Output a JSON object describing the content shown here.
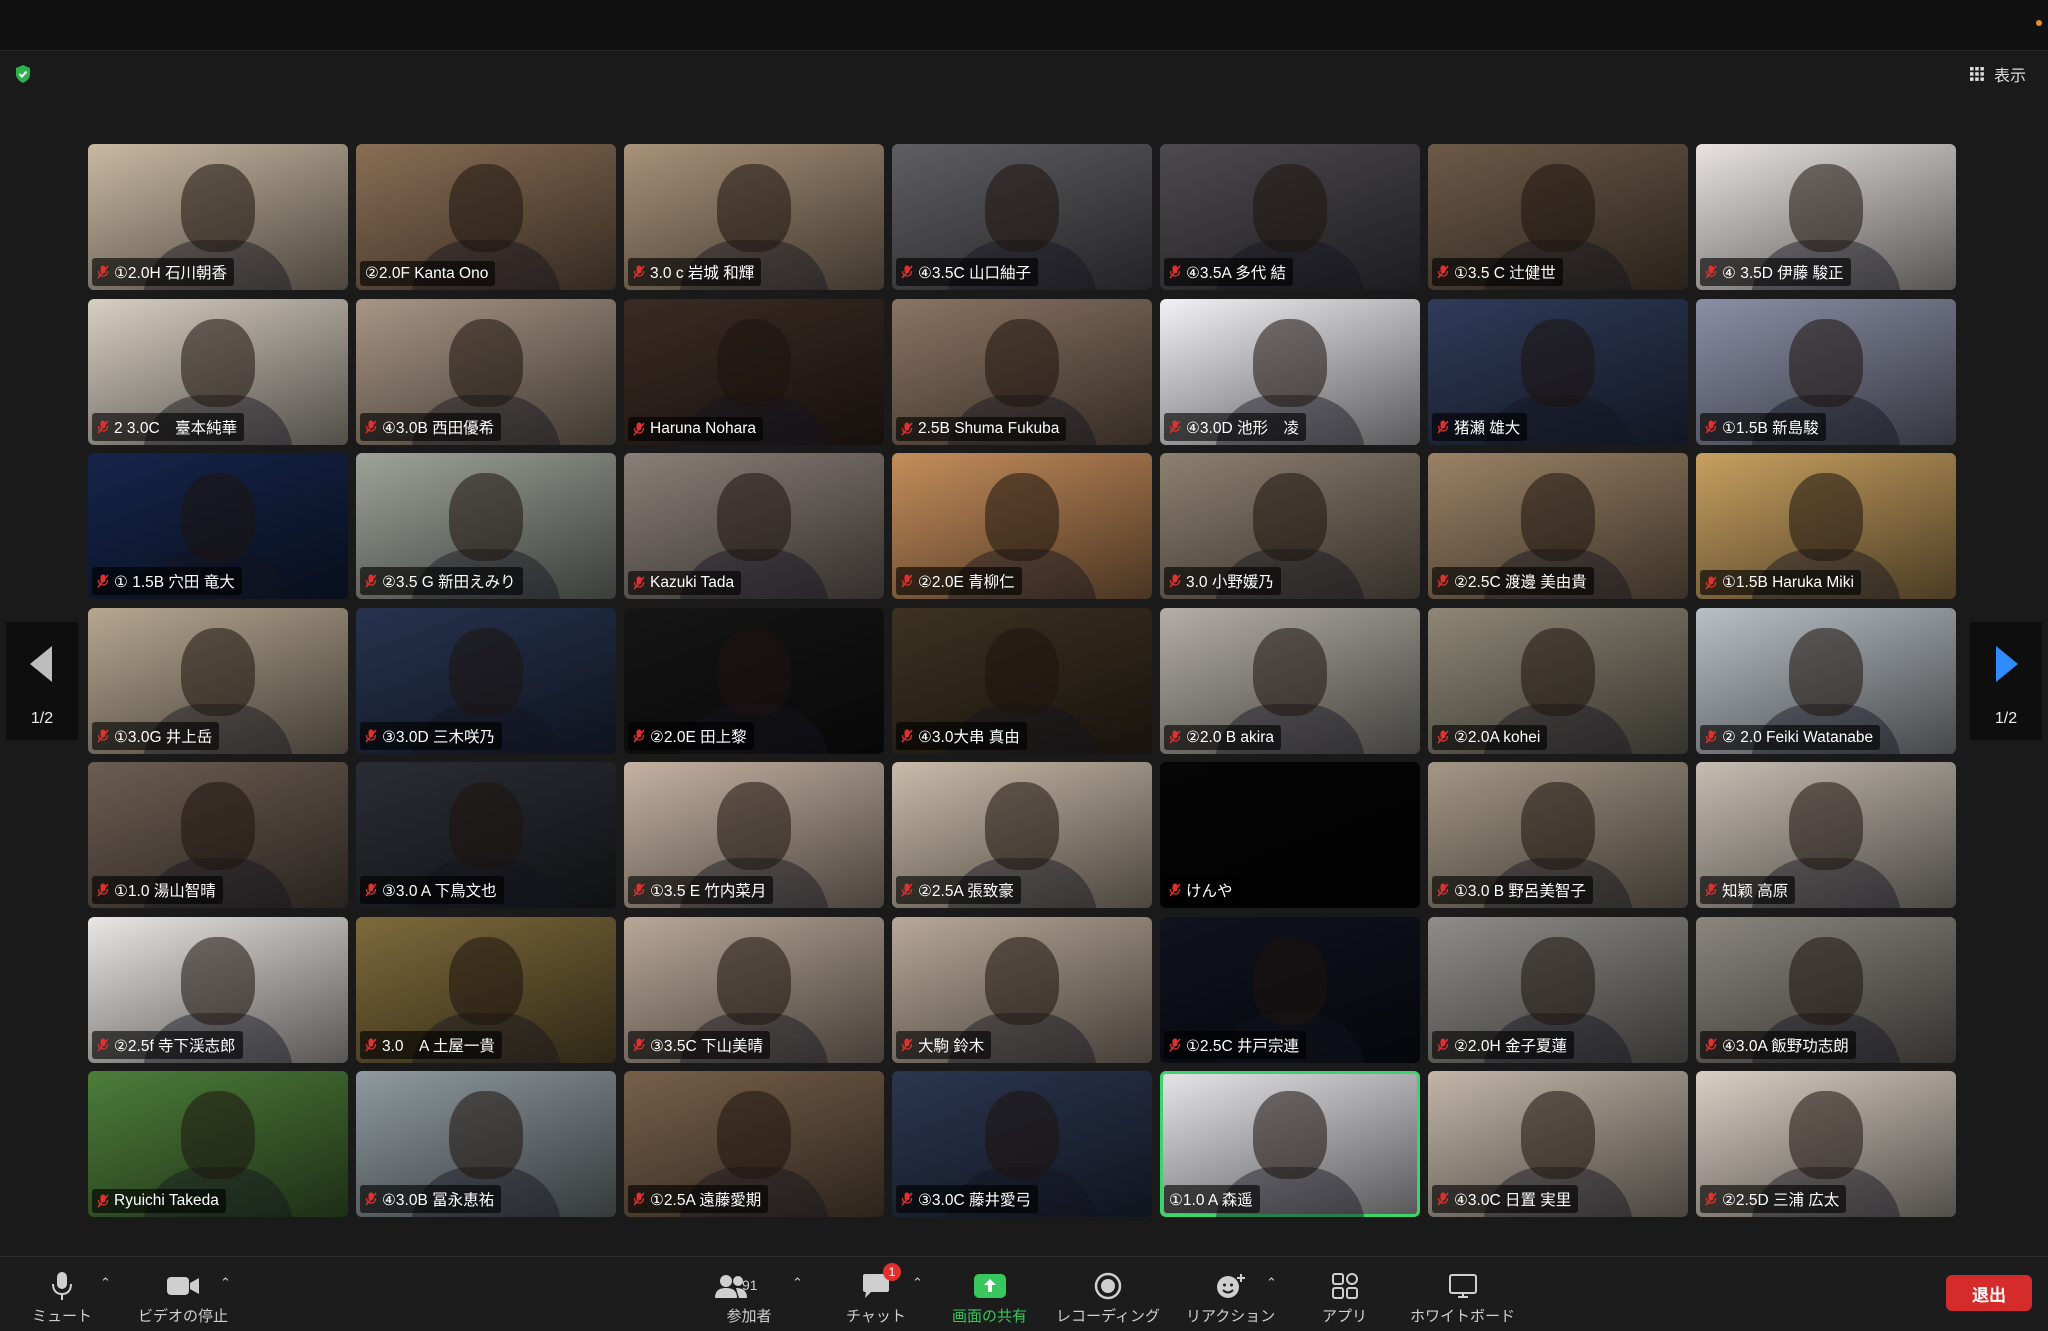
{
  "meeting": {
    "view_label": "表示",
    "page_indicator": "1/2",
    "colors": {
      "active_speaker_border": "#3fd36d",
      "leave_button": "#d62b2b",
      "share_green": "#38c75d",
      "muted_mic": "#e0302f"
    }
  },
  "participants": [
    {
      "name": "①2.0H 石川朝香",
      "bg": "#c9b9a3",
      "muted": true
    },
    {
      "name": "②2.0F Kanta Ono",
      "bg": "#8a6e55",
      "muted": false
    },
    {
      "name": "3.0 c 岩城 和輝",
      "bg": "#a89279",
      "muted": true
    },
    {
      "name": "④3.5C 山口紬子",
      "bg": "#5f5e63",
      "muted": true
    },
    {
      "name": "④3.5A 多代 結",
      "bg": "#4c4a4f",
      "muted": true
    },
    {
      "name": "①3.5 C 辻健世",
      "bg": "#6d5a48",
      "muted": true
    },
    {
      "name": "④ 3.5D 伊藤 駿正",
      "bg": "#e8e3e0",
      "muted": true
    },
    {
      "name": "2 3.0C　臺本純華",
      "bg": "#d8cfc2",
      "muted": true
    },
    {
      "name": "④3.0B 西田優希",
      "bg": "#a89584",
      "muted": true
    },
    {
      "name": "Haruna Nohara",
      "bg": "#3b2b24",
      "muted": true
    },
    {
      "name": "2.5B Shuma Fukuba",
      "bg": "#8b7462",
      "muted": true
    },
    {
      "name": "④3.0D 池形　凌",
      "bg": "#f2f2f6",
      "muted": true
    },
    {
      "name": "猪瀬 雄大",
      "bg": "#2f3b5a",
      "muted": true
    },
    {
      "name": "①1.5B 新島駿",
      "bg": "#8b8fa6",
      "muted": true
    },
    {
      "name": "① 1.5B 穴田 竜大",
      "bg": "#15254a",
      "muted": true
    },
    {
      "name": "②3.5 G 新田えみり",
      "bg": "#9ea39a",
      "muted": true
    },
    {
      "name": "Kazuki Tada",
      "bg": "#8a7f78",
      "muted": true
    },
    {
      "name": "②2.0E 青柳仁",
      "bg": "#c58d5b",
      "muted": true
    },
    {
      "name": "3.0 小野媛乃",
      "bg": "#8d8070",
      "muted": true
    },
    {
      "name": "②2.5C 渡邊 美由貴",
      "bg": "#9b8266",
      "muted": true
    },
    {
      "name": "①1.5B Haruka Miki",
      "bg": "#c7a060",
      "muted": true
    },
    {
      "name": "①3.0G 井上岳",
      "bg": "#b6a791",
      "muted": true
    },
    {
      "name": "③3.0D 三木咲乃",
      "bg": "#26334f",
      "muted": true
    },
    {
      "name": "②2.0E 田上黎",
      "bg": "#151515",
      "muted": true
    },
    {
      "name": "④3.0大串 真由",
      "bg": "#3d3222",
      "muted": true
    },
    {
      "name": "②2.0 B akira",
      "bg": "#b3aea6",
      "muted": true
    },
    {
      "name": "②2.0A kohei",
      "bg": "#8e8776",
      "muted": true
    },
    {
      "name": "② 2.0 Feiki Watanabe",
      "bg": "#b9c0c6",
      "muted": true
    },
    {
      "name": "①1.0 湯山智晴",
      "bg": "#6c5d52",
      "muted": true
    },
    {
      "name": "③3.0 A 下鳥文也",
      "bg": "#2b2d35",
      "muted": true
    },
    {
      "name": "①3.5 E 竹内菜月",
      "bg": "#c5b2a2",
      "muted": true
    },
    {
      "name": "②2.5A 張致豪",
      "bg": "#c9bba9",
      "muted": true
    },
    {
      "name": "けんや",
      "bg": "#050505",
      "muted": true
    },
    {
      "name": "①3.0 B 野呂美智子",
      "bg": "#a49785",
      "muted": true
    },
    {
      "name": "知颖 高原",
      "bg": "#c6bdb2",
      "muted": true
    },
    {
      "name": "②2.5f 寺下渓志郎",
      "bg": "#e9e6e4",
      "muted": true
    },
    {
      "name": "3.0　A 土屋一貴",
      "bg": "#7e6a3b",
      "muted": true
    },
    {
      "name": "③3.5C 下山美晴",
      "bg": "#b8a797",
      "muted": true
    },
    {
      "name": "大駒 鈴木",
      "bg": "#b8a898",
      "muted": true
    },
    {
      "name": "①2.5C 井戸宗連",
      "bg": "#10131f",
      "muted": true
    },
    {
      "name": "②2.0H 金子夏蓮",
      "bg": "#8e8d89",
      "muted": true
    },
    {
      "name": "④3.0A 飯野功志朗",
      "bg": "#8a867e",
      "muted": true
    },
    {
      "name": "Ryuichi Takeda",
      "bg": "#4d7d3a",
      "muted": true
    },
    {
      "name": "④3.0B 冨永恵祐",
      "bg": "#8f9a9f",
      "muted": true
    },
    {
      "name": "①2.5A 遠藤愛期",
      "bg": "#77604a",
      "muted": true
    },
    {
      "name": "③3.0C 藤井愛弓",
      "bg": "#2b3650",
      "muted": true
    },
    {
      "name": "①1.0 A 森遥",
      "bg": "#e7e7ea",
      "muted": false,
      "active": true
    },
    {
      "name": "④3.0C 日置 実里",
      "bg": "#c2b6a8",
      "muted": true
    },
    {
      "name": "②2.5D 三浦 広太",
      "bg": "#d9cfc4",
      "muted": true
    }
  ],
  "toolbar": {
    "mute_label": "ミュート",
    "video_label": "ビデオの停止",
    "participants_label": "参加者",
    "participants_count": "91",
    "chat_label": "チャット",
    "chat_badge": "1",
    "share_label": "画面の共有",
    "record_label": "レコーディング",
    "reactions_label": "リアクション",
    "apps_label": "アプリ",
    "whiteboard_label": "ホワイトボード",
    "leave_label": "退出"
  }
}
